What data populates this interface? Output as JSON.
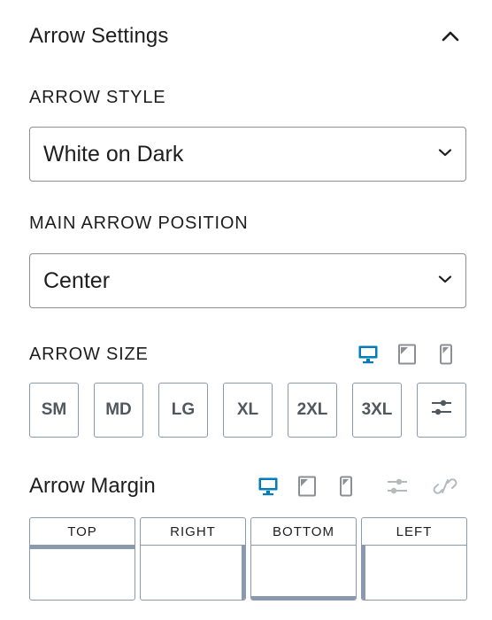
{
  "panel": {
    "title": "Arrow Settings"
  },
  "arrow_style": {
    "label": "ARROW STYLE",
    "value": "White on Dark"
  },
  "arrow_position": {
    "label": "MAIN ARROW POSITION",
    "value": "Center"
  },
  "arrow_size": {
    "label": "ARROW SIZE",
    "options": [
      "SM",
      "MD",
      "LG",
      "XL",
      "2XL",
      "3XL"
    ],
    "active_device": "desktop"
  },
  "arrow_margin": {
    "label": "Arrow Margin",
    "sides": [
      "TOP",
      "RIGHT",
      "BOTTOM",
      "LEFT"
    ],
    "active_device": "desktop"
  },
  "colors": {
    "accent": "#007cba",
    "border": "#8a99ab",
    "icon_gray": "#8c8f94"
  }
}
